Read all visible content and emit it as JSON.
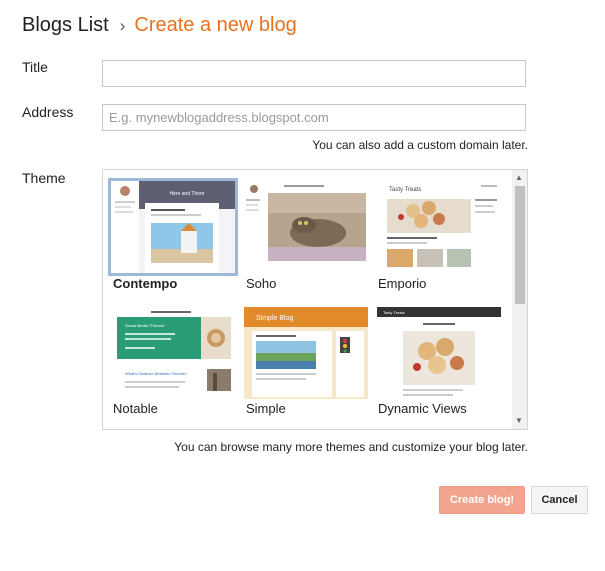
{
  "header": {
    "breadcrumb_root": "Blogs List",
    "separator": "›",
    "current": "Create a new blog"
  },
  "form": {
    "title_label": "Title",
    "title_value": "",
    "address_label": "Address",
    "address_placeholder": "E.g. mynewblogaddress.blogspot.com",
    "address_hint": "You can also add a custom domain later.",
    "theme_label": "Theme",
    "theme_hint": "You can browse many more themes and customize your blog later."
  },
  "themes": [
    {
      "name": "Contempo",
      "selected": true
    },
    {
      "name": "Soho",
      "selected": false
    },
    {
      "name": "Emporio",
      "selected": false
    },
    {
      "name": "Notable",
      "selected": false
    },
    {
      "name": "Simple",
      "selected": false
    },
    {
      "name": "Dynamic Views",
      "selected": false
    }
  ],
  "thumb_text": {
    "contempo_banner": "Here and There",
    "emporio_title": "Tasty Treats",
    "notable_headline": "Social Media \"Friends\"",
    "notable_subheadline": "What's Distance Between Friends?",
    "simple_title": "Simple Blog",
    "dynamic_title": "Tasty Treats"
  },
  "buttons": {
    "create": "Create blog!",
    "cancel": "Cancel"
  },
  "colors": {
    "accent": "#e8711e",
    "selected_outline": "#9fb8d8",
    "create_button": "#f2a48f",
    "notable_green": "#2a9d78",
    "simple_orange": "#e08a2a"
  }
}
